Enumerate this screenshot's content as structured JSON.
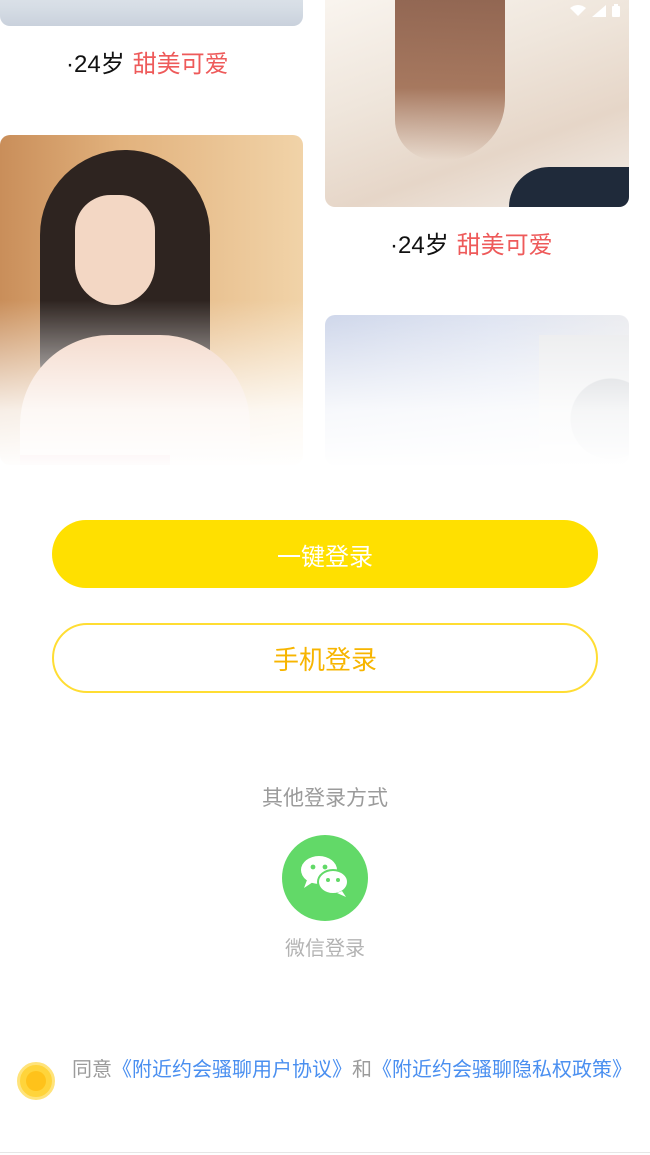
{
  "cards": [
    {
      "age": "·24岁",
      "tag": "甜美可爱"
    },
    {
      "age": "·24岁",
      "tag": "甜美可爱"
    }
  ],
  "buttons": {
    "one_click_login": "一键登录",
    "phone_login": "手机登录"
  },
  "other_login": {
    "title": "其他登录方式",
    "wechat_label": "微信登录",
    "wechat_icon": "wechat-icon"
  },
  "agreement": {
    "prefix": "同意",
    "user_agreement": "《附近约会骚聊用户协议》",
    "and": "和",
    "privacy_policy": "《附近约会骚聊隐私权政策》",
    "checked": true
  },
  "colors": {
    "primary": "#ffe000",
    "outline_text": "#f7b500",
    "tag": "#ee5a5a",
    "link": "#4a8ff0",
    "wechat": "#62d968"
  }
}
